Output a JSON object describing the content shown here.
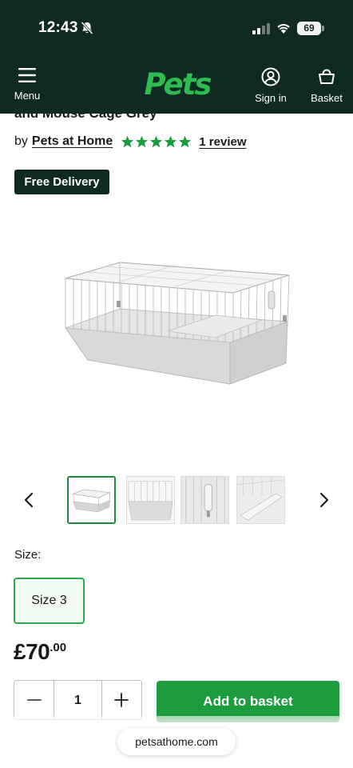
{
  "status_bar": {
    "time": "12:43",
    "battery": "69"
  },
  "header": {
    "menu_label": "Menu",
    "logo_text": "Pets",
    "signin_label": "Sign in",
    "basket_label": "Basket",
    "colors": {
      "background": "#0e2a22",
      "logo": "#2dbb52"
    }
  },
  "product": {
    "title_fragment": "and Mouse Cage Grey",
    "by_prefix": "by",
    "brand": "Pets at Home",
    "rating": 5,
    "rating_max": 5,
    "review_link": "1 review",
    "delivery_badge": "Free Delivery",
    "gallery": {
      "prev_icon": "chevron-left-icon",
      "next_icon": "chevron-right-icon",
      "thumbnails": [
        "cage-front",
        "cage-side",
        "cage-bottle-detail",
        "cage-ramp-detail"
      ],
      "active_index": 0
    },
    "size_label": "Size:",
    "size_options": [
      "Size 3"
    ],
    "selected_size": "Size 3",
    "price_main": "£70",
    "price_pence": ".00",
    "quantity": "1",
    "add_to_basket": "Add to basket",
    "colors": {
      "accent": "#1d9b3f",
      "stars": "#1d9b3f"
    }
  },
  "browser": {
    "url": "petsathome.com"
  }
}
